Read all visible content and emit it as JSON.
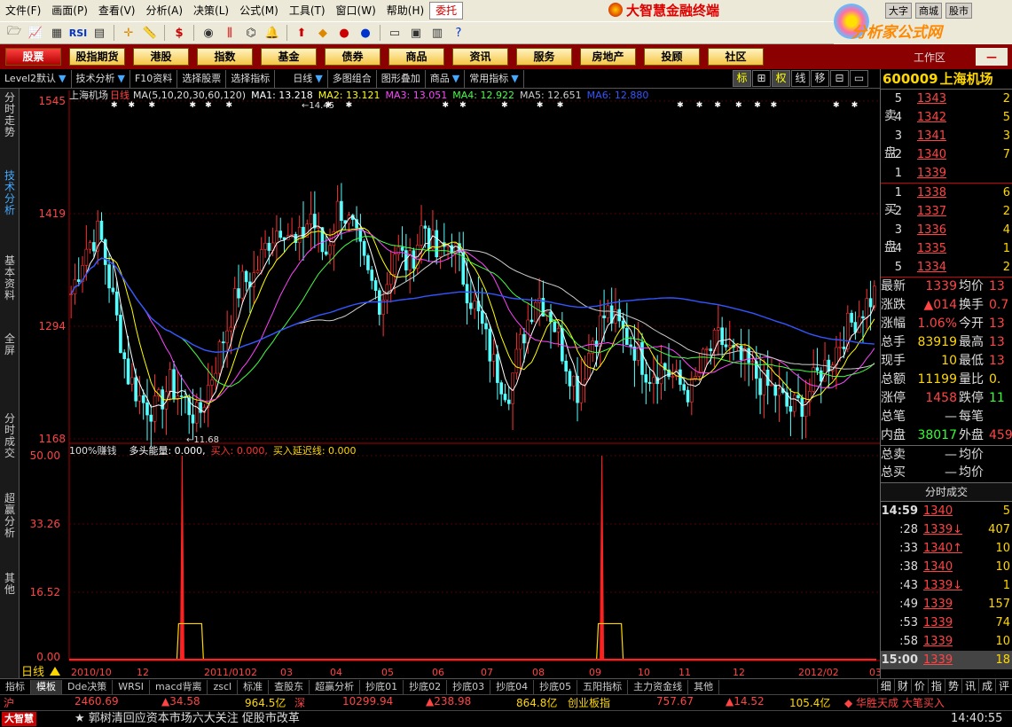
{
  "menu": [
    "文件(F)",
    "画面(P)",
    "查看(V)",
    "分析(A)",
    "决策(L)",
    "公式(M)",
    "工具(T)",
    "窗口(W)",
    "帮助(H)",
    "委托"
  ],
  "brand_title": "大智慧金融终端",
  "top_buttons": [
    "大字",
    "商城",
    "股市"
  ],
  "site_logo": "分析家公式网",
  "categories": [
    "股票",
    "股指期货",
    "港股",
    "指数",
    "基金",
    "债券",
    "商品",
    "资讯",
    "服务",
    "房地产",
    "投顾",
    "社区"
  ],
  "workspace": "工作区",
  "subbar": [
    {
      "label": "Level2默认"
    },
    {
      "label": "技术分析"
    },
    {
      "label": "F10资料"
    },
    {
      "label": "选择股票"
    },
    {
      "label": "选择指标"
    },
    {
      "label": "日线"
    },
    {
      "label": "多图组合"
    },
    {
      "label": "图形叠加"
    },
    {
      "label": "商品"
    },
    {
      "label": "常用指标"
    }
  ],
  "mode_buttons": [
    "标",
    "⊞",
    "权",
    "线",
    "移",
    "⊟",
    "▭"
  ],
  "side_tabs": [
    "分时走势",
    "技术分析",
    "基本资料",
    "全屏",
    "分时成交",
    "超赢分析",
    "其他"
  ],
  "chart": {
    "stock_name": "上海机场",
    "period": "日线",
    "ma_params": "MA(5,10,20,30,60,120)",
    "ma_values": [
      {
        "label": "MA1: 13.218",
        "color": "#ffffff"
      },
      {
        "label": "MA2: 13.121",
        "color": "#ffff00"
      },
      {
        "label": "MA3: 13.051",
        "color": "#ff44ff"
      },
      {
        "label": "MA4: 12.922",
        "color": "#44ff44"
      },
      {
        "label": "MA5: 12.651",
        "color": "#cccccc"
      },
      {
        "label": "MA6: 12.880",
        "color": "#3355ff"
      }
    ],
    "y_ticks": [
      "1545",
      "1419",
      "1294",
      "1168"
    ],
    "high_note": "←14.45",
    "low_note": "←11.68",
    "indicator_title": "100%赚钱",
    "indicator_values": [
      {
        "label": "多头能量: 0.000,",
        "color": "#ffffff"
      },
      {
        "label": "买入: 0.000,",
        "color": "#ff3333"
      },
      {
        "label": "买入延迟线: 0.000",
        "color": "#ffd700"
      }
    ],
    "ind_y_ticks": [
      "50.00",
      "33.26",
      "16.52",
      "0.00"
    ],
    "x_labels": [
      "2010/10",
      "12",
      "2011/01",
      "02",
      "03",
      "04",
      "05",
      "06",
      "07",
      "08",
      "09",
      "10",
      "11",
      "12",
      "2012/02",
      "03"
    ],
    "period_label": "日线"
  },
  "chart_data": [
    {
      "type": "candlestick",
      "title": "上海机场 日线",
      "ylim": [
        11.68,
        15.45
      ],
      "x_labels": [
        "2010/10",
        "12",
        "2011/01",
        "02",
        "03",
        "04",
        "05",
        "06",
        "07",
        "08",
        "09",
        "10",
        "11",
        "12",
        "2012/02",
        "03"
      ],
      "high": 14.45,
      "low": 11.68,
      "last": 13.39,
      "ma_last": {
        "MA1": 13.218,
        "MA2": 13.121,
        "MA3": 13.051,
        "MA4": 12.922,
        "MA5": 12.651,
        "MA6": 12.88
      },
      "close_path": [
        13.3,
        13.8,
        14.0,
        13.2,
        12.4,
        12.1,
        12.0,
        12.3,
        12.1,
        11.9,
        12.4,
        12.9,
        13.4,
        13.5,
        13.9,
        14.1,
        13.8,
        14.2,
        13.7,
        14.3,
        14.0,
        13.5,
        13.2,
        13.8,
        13.6,
        14.1,
        13.7,
        13.9,
        13.4,
        13.0,
        12.5,
        12.2,
        12.8,
        13.3,
        13.1,
        12.6,
        12.2,
        12.8,
        13.1,
        12.9,
        12.7,
        12.4,
        12.5,
        12.3,
        12.2,
        12.6,
        12.8,
        12.6,
        12.5,
        12.3,
        12.2,
        12.0,
        12.1,
        12.4,
        12.6,
        12.9,
        13.1,
        13.3
      ]
    },
    {
      "type": "bar",
      "title": "100%赚钱",
      "ylim": [
        0,
        50
      ],
      "series": [
        {
          "name": "买入",
          "spikes_at_fraction": [
            0.14,
            0.66
          ],
          "values": [
            50,
            50
          ]
        }
      ]
    }
  ],
  "right": {
    "code": "600009",
    "name": "上海机场",
    "sell_label": [
      "卖",
      "盘"
    ],
    "buy_label": [
      "买",
      "盘"
    ],
    "sell": [
      {
        "lv": "5",
        "price": "1343",
        "vol": "2"
      },
      {
        "lv": "4",
        "price": "1342",
        "vol": "5"
      },
      {
        "lv": "3",
        "price": "1341",
        "vol": "3"
      },
      {
        "lv": "2",
        "price": "1340",
        "vol": "7"
      },
      {
        "lv": "1",
        "price": "1339",
        "vol": ""
      }
    ],
    "buy": [
      {
        "lv": "1",
        "price": "1338",
        "vol": "6"
      },
      {
        "lv": "2",
        "price": "1337",
        "vol": "2"
      },
      {
        "lv": "3",
        "price": "1336",
        "vol": "4"
      },
      {
        "lv": "4",
        "price": "1335",
        "vol": "1"
      },
      {
        "lv": "5",
        "price": "1334",
        "vol": "2"
      }
    ],
    "quotes": [
      {
        "k1": "最新",
        "v1": "1339",
        "k2": "均价",
        "v2": "13"
      },
      {
        "k1": "涨跌",
        "v1": "▲014",
        "k2": "换手",
        "v2": "0.7"
      },
      {
        "k1": "涨幅",
        "v1": "1.06%",
        "k2": "今开",
        "v2": "13"
      },
      {
        "k1": "总手",
        "v1": "83919",
        "k2": "最高",
        "v2": "13"
      },
      {
        "k1": "现手",
        "v1": "10",
        "k2": "最低",
        "v2": "13"
      },
      {
        "k1": "总额",
        "v1": "11199",
        "k2": "量比",
        "v2": "0."
      },
      {
        "k1": "涨停",
        "v1": "1458",
        "k2": "跌停",
        "v2": "11"
      },
      {
        "k1": "总笔",
        "v1": "—",
        "k2": "每笔",
        "v2": ""
      },
      {
        "k1": "内盘",
        "v1": "38017",
        "k2": "外盘",
        "v2": "459"
      },
      {
        "k1": "总卖",
        "v1": "—",
        "k2": "均价",
        "v2": ""
      },
      {
        "k1": "总买",
        "v1": "—",
        "k2": "均价",
        "v2": ""
      }
    ],
    "trade_header": "分时成交",
    "trades": [
      {
        "t": "14:59",
        "p": "1340",
        "v": "5"
      },
      {
        "t": ":28",
        "p": "1339↓",
        "v": "407"
      },
      {
        "t": ":33",
        "p": "1340↑",
        "v": "10"
      },
      {
        "t": ":38",
        "p": "1340",
        "v": "10"
      },
      {
        "t": ":43",
        "p": "1339↓",
        "v": "1"
      },
      {
        "t": ":49",
        "p": "1339",
        "v": "157"
      },
      {
        "t": ":53",
        "p": "1339",
        "v": "74"
      },
      {
        "t": ":58",
        "p": "1339",
        "v": "10"
      },
      {
        "t": "15:00",
        "p": "1339",
        "v": "18"
      }
    ]
  },
  "bottom_tabs": [
    "指标",
    "模板",
    "Dde决策",
    "WRSI",
    "macd背离",
    "zscl",
    "标准",
    "查股东",
    "超赢分析",
    "抄底01",
    "抄底02",
    "抄底03",
    "抄底04",
    "抄底05",
    "五阳指标",
    "主力资金线",
    "其他"
  ],
  "right_tabs": [
    "细",
    "财",
    "价",
    "指",
    "势",
    "讯",
    "成",
    "评"
  ],
  "status": [
    {
      "text": "沪",
      "color": "#ff4444"
    },
    {
      "text": "2460.69",
      "color": "#ff4444"
    },
    {
      "text": "▲34.58",
      "color": "#ff4444"
    },
    {
      "text": "964.5亿",
      "color": "#ffd700"
    },
    {
      "text": "深",
      "color": "#ff4444"
    },
    {
      "text": "10299.94",
      "color": "#ff4444"
    },
    {
      "text": "▲238.98",
      "color": "#ff4444"
    },
    {
      "text": "864.8亿",
      "color": "#ffd700"
    },
    {
      "text": "创业板指",
      "color": "#ffd700"
    },
    {
      "text": "757.67",
      "color": "#ff4444"
    },
    {
      "text": "▲14.52",
      "color": "#ff4444"
    },
    {
      "text": "105.4亿",
      "color": "#ffd700"
    },
    {
      "text": "◆ 华胜天成 大笔买入",
      "color": "#ff4444"
    }
  ],
  "ticker": {
    "brand": "大智慧",
    "text": "★ 郭树清回应资本市场六大关注 促股市改革",
    "time": "14:40:55"
  }
}
